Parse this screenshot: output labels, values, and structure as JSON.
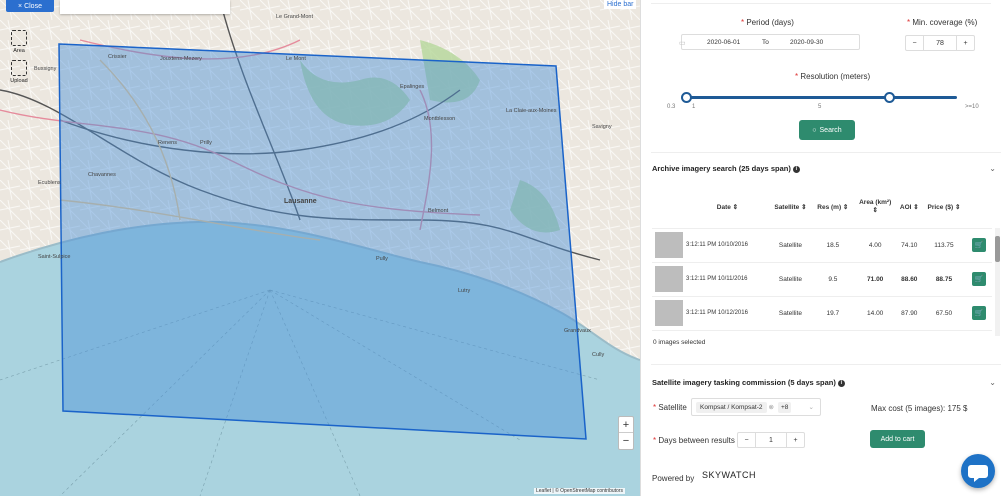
{
  "map": {
    "close_label": "× Close",
    "hide_bar_label": "Hide bar",
    "tools": [
      {
        "label": "Area",
        "icon": "area-select-icon"
      },
      {
        "label": "Upload",
        "icon": "upload-icon"
      }
    ],
    "zoom_in": "+",
    "zoom_out": "−",
    "attribution": "Leaflet | © OpenStreetMap contributors",
    "places": [
      "Crissier",
      "Jouxtens-Mezery",
      "Le Mont",
      "Bussigny",
      "Renens",
      "Prilly",
      "Lausanne",
      "Ecublens",
      "Chavannes",
      "Saint-Sulpice",
      "Pully",
      "Epalinges",
      "Belmont",
      "Lutry",
      "Savigny",
      "Grandvaux",
      "Cully",
      "Le Grand-Mont",
      "Montblesson",
      "La Claie-aux-Moines"
    ]
  },
  "panel": {
    "period_label": "Period (days)",
    "coverage_label": "Min. coverage (%)",
    "date_from": "2020-06-01",
    "date_to_label": "To",
    "date_to": "2020-09-30",
    "coverage_minus": "−",
    "coverage_value": "78",
    "coverage_plus": "+",
    "resolution_label": "Resolution (meters)",
    "slider_min": "0.3",
    "slider_tick_1": "1",
    "slider_tick_2": "5",
    "slider_max": ">=10",
    "search_label": "Search",
    "archive_title": "Archive imagery search (25 days span)",
    "columns": [
      "Date",
      "Satellite",
      "Res (m)",
      "Area (km²)",
      "AOI",
      "Price ($)"
    ],
    "rows": [
      {
        "date": "3:12:11 PM 10/10/2016",
        "satellite": "Satellite",
        "res": "18.5",
        "area": "4.00",
        "aoi": "74.10",
        "price": "113.75"
      },
      {
        "date": "3:12:11 PM 10/11/2016",
        "satellite": "Satellite",
        "res": "9.5",
        "area": "71.00",
        "aoi": "88.60",
        "price": "88.75"
      },
      {
        "date": "3:12:11 PM 10/12/2016",
        "satellite": "Satellite",
        "res": "19.7",
        "area": "14.00",
        "aoi": "87.90",
        "price": "67.50"
      }
    ],
    "selected_label": "0 images selected",
    "tasking_title": "Satellite imagery tasking commission (5 days span)",
    "satellite_label": "Satellite",
    "satellite_chip": "Kompsat / Kompsat-2",
    "satellite_more": "+8",
    "max_cost": "Max cost (5 images): 175 $",
    "days_label": "Days between results",
    "days_minus": "−",
    "days_value": "1",
    "days_plus": "+",
    "add_to_cart": "Add to cart",
    "powered_by": "Powered by",
    "brand": "SKYWATCH",
    "colors": {
      "accent": "#2e8b6e",
      "slider": "#1e5a96",
      "aoi_fill": "#4a90d9",
      "chat": "#1e72c6"
    }
  }
}
